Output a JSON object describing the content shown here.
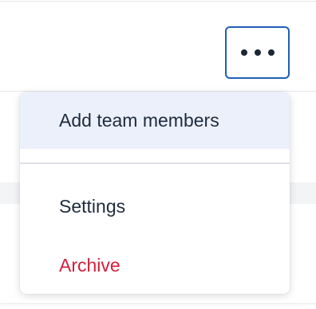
{
  "header": {
    "more_button_icon": "more-horizontal-icon",
    "accent_color": "#1f5fb7"
  },
  "menu": {
    "items": [
      {
        "label": "Add team members",
        "state": "highlighted"
      },
      {
        "label": "Settings"
      },
      {
        "label": "Archive",
        "variant": "danger",
        "color": "#d2203c"
      }
    ]
  }
}
